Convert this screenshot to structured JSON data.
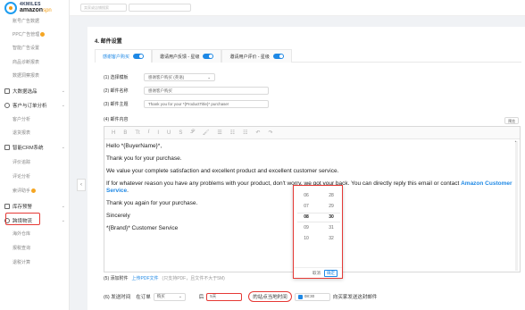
{
  "logo": {
    "top": "4KMILES",
    "bottom": "amazon",
    "suffix": "spn"
  },
  "topbar": {
    "shop_placeholder": "卖家或店铺搜索",
    "filter_placeholder": ""
  },
  "sidebar": {
    "items": [
      {
        "label": "账号广告数据",
        "kind": "sub"
      },
      {
        "label": "PPC广告管理",
        "kind": "sub",
        "badge": true
      },
      {
        "label": "智能广告设置",
        "kind": "sub"
      },
      {
        "label": "商品诊断报表",
        "kind": "sub"
      },
      {
        "label": "数据洞察报表",
        "kind": "sub"
      },
      {
        "label": "大数据选品",
        "kind": "group",
        "badge": true
      },
      {
        "label": "客户与订单分析",
        "kind": "group"
      },
      {
        "label": "客户分析",
        "kind": "sub"
      },
      {
        "label": "退货报表",
        "kind": "sub"
      },
      {
        "label": "智能CRM系统",
        "kind": "group",
        "badge": true
      },
      {
        "label": "评价追踪",
        "kind": "sub"
      },
      {
        "label": "评论分析",
        "kind": "sub"
      },
      {
        "label": "索评助手",
        "kind": "sub",
        "badge": true
      },
      {
        "label": "库存预警",
        "kind": "group"
      },
      {
        "label": "跨境物流",
        "kind": "group"
      },
      {
        "label": "海外仓库",
        "kind": "sub"
      },
      {
        "label": "报税查询",
        "kind": "sub"
      },
      {
        "label": "退税计算",
        "kind": "sub"
      }
    ]
  },
  "section": {
    "title": "4. 邮件设置"
  },
  "tabs": [
    {
      "label": "感谢客户购买",
      "active": true
    },
    {
      "label": "邀请用户反馈 - 星级",
      "active": false
    },
    {
      "label": "邀请用户评价 - 星级",
      "active": false
    }
  ],
  "form": {
    "template": {
      "label": "(1) 选择模板",
      "value": "感谢客户购买 (英语)"
    },
    "name": {
      "label": "(2) 邮件名称",
      "value": "感谢客户购买"
    },
    "subject": {
      "label": "(3) 邮件主题",
      "value": "Thank you for your *{ProductTitle}* purchase!"
    },
    "content": {
      "label": "(4) 邮件内容"
    },
    "preview_label": "预览"
  },
  "toolbar": [
    "H",
    "B",
    "Tt",
    "𝐼",
    "I",
    "U",
    "S",
    "𝒫",
    "🖌",
    "☰",
    "☷",
    "☷",
    "↶",
    "↷"
  ],
  "editor": {
    "line1": "Hello *{BuyerName}*,",
    "line2": "Thank you for your purchase.",
    "line3": "We value your complete satisfaction and excellent product and excellent customer service.",
    "line4_pre": "If for whatever reason you have any problems with your product, don't worry, we got your back. You can directly reply this email or contact ",
    "line4_link": "Amazon Customer Service",
    "line4_post": ".",
    "line5": "Thank you again for your purchase.",
    "line6": "Sincerely",
    "line7": "*{Brand}* Customer Service"
  },
  "picker": {
    "rows": [
      [
        "06",
        "28"
      ],
      [
        "07",
        "29"
      ],
      [
        "08",
        "30"
      ],
      [
        "09",
        "31"
      ],
      [
        "10",
        "32"
      ]
    ],
    "selected_index": 2,
    "cancel": "取消",
    "ok": "确定"
  },
  "attach": {
    "label": "(5) 添加附件",
    "link": "上传PDF文件",
    "hint": "(只支持PDF，且文件不大于5M)"
  },
  "send": {
    "label": "(6) 发送时间",
    "prefix": "在订单",
    "event": "购买",
    "after": "后",
    "days": "5天",
    "at_label": "的站点当地时间",
    "time": "08:30",
    "suffix": "向买家发送这封邮件"
  },
  "colors": {
    "accent": "#1e88e5",
    "highlight": "#e53935",
    "badge": "#f5a623"
  }
}
